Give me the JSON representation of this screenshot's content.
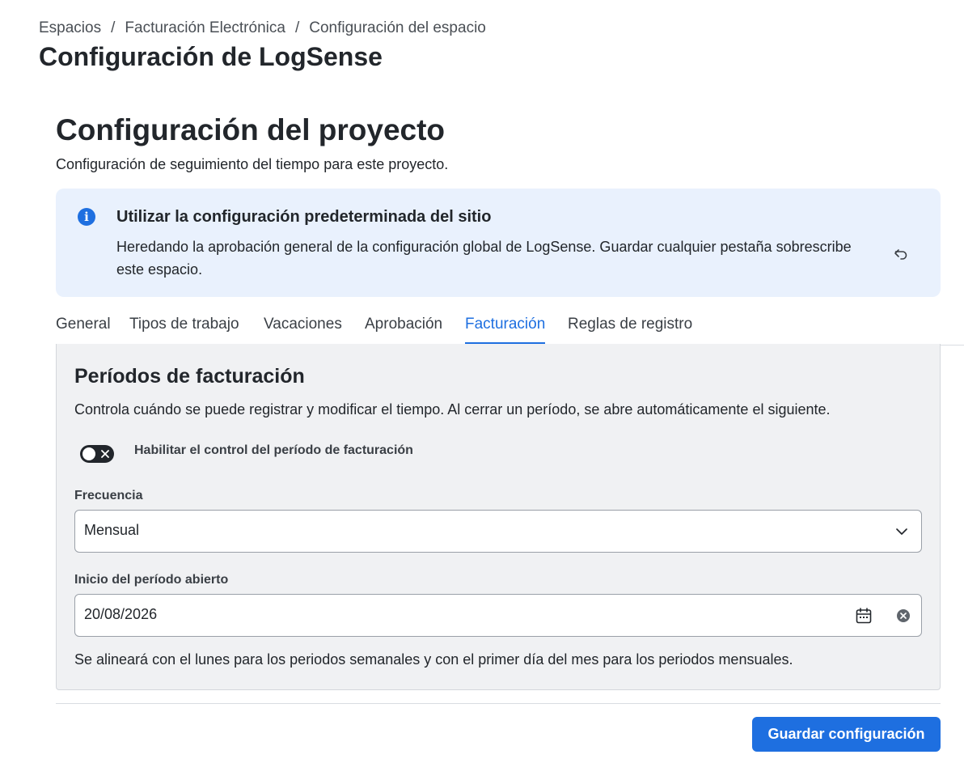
{
  "breadcrumb": {
    "items": [
      "Espacios",
      "Facturación Electrónica",
      "Configuración del espacio"
    ],
    "separator": "/"
  },
  "page": {
    "title": "Configuración de LogSense"
  },
  "project": {
    "title": "Configuración del proyecto",
    "subtitle": "Configuración de seguimiento del tiempo para este proyecto."
  },
  "info": {
    "icon": "info-icon",
    "title": "Utilizar la configuración predeterminada del sitio",
    "text": "Heredando la aprobación general de la configuración global de LogSense. Guardar cualquier pestaña sobrescribe este espacio.",
    "action_icon": "undo-icon"
  },
  "tabs": [
    {
      "label": "General",
      "active": false
    },
    {
      "label": "Tipos de trabajo",
      "active": false
    },
    {
      "label": "Vacaciones",
      "active": false
    },
    {
      "label": "Aprobación",
      "active": false
    },
    {
      "label": "Facturación",
      "active": true
    },
    {
      "label": "Reglas de registro",
      "active": false
    }
  ],
  "panel": {
    "title": "Períodos de facturación",
    "description": "Controla cuándo se puede registrar y modificar el tiempo. Al cerrar un período, se abre automáticamente el siguiente.",
    "toggle": {
      "label": "Habilitar el control del período de facturación",
      "enabled": false
    },
    "frequency": {
      "label": "Frecuencia",
      "value": "Mensual"
    },
    "start": {
      "label": "Inicio del período abierto",
      "value": "20/08/2026"
    },
    "helper": "Se alineará con el lunes para los periodos semanales y con el primer día del mes para los periodos mensuales."
  },
  "actions": {
    "save_label": "Guardar configuración"
  },
  "colors": {
    "accent": "#1e6fe0",
    "info_bg": "#e9f1fd",
    "panel_bg": "#f0f1f3"
  }
}
